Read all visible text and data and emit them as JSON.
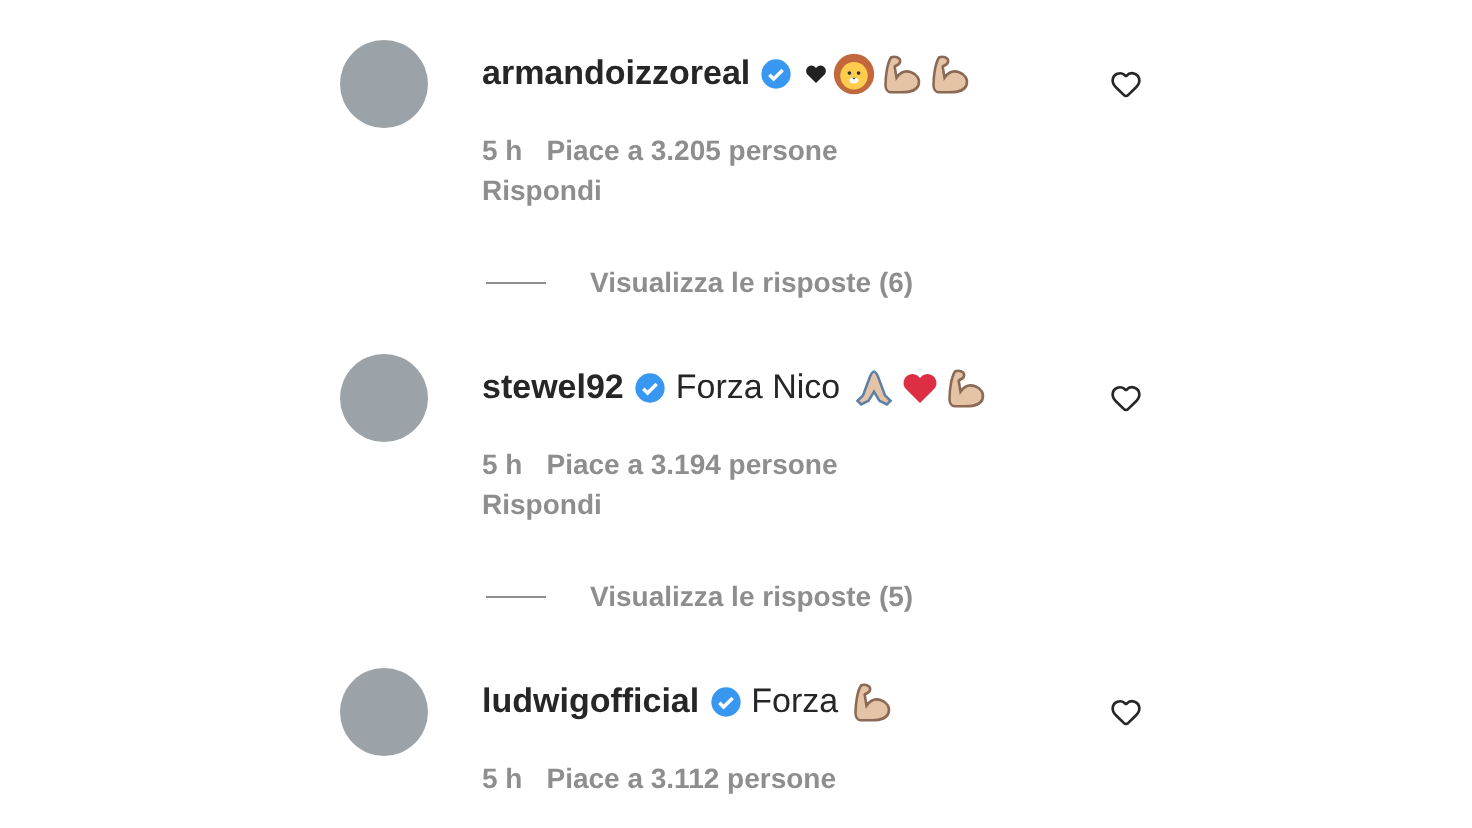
{
  "comments": [
    {
      "username": "armandoizzoreal",
      "verified": true,
      "emojis": [
        {
          "kind": "black-heart"
        },
        {
          "kind": "lion"
        },
        {
          "kind": "muscle"
        },
        {
          "kind": "muscle"
        }
      ],
      "time": "5 h",
      "likes": "Piace a 3.205 persone",
      "reply": "Rispondi",
      "view_replies": "Visualizza le risposte (6)"
    },
    {
      "username": "stewel92",
      "verified": true,
      "text": "Forza Nico",
      "emojis": [
        {
          "kind": "pray"
        },
        {
          "kind": "red-heart"
        },
        {
          "kind": "muscle"
        }
      ],
      "time": "5 h",
      "likes": "Piace a 3.194 persone",
      "reply": "Rispondi",
      "view_replies": "Visualizza le risposte (5)"
    },
    {
      "username": "ludwigofficial",
      "verified": true,
      "text": "Forza",
      "emojis": [
        {
          "kind": "muscle"
        }
      ],
      "time": "5 h",
      "likes": "Piace a 3.112 persone"
    }
  ]
}
